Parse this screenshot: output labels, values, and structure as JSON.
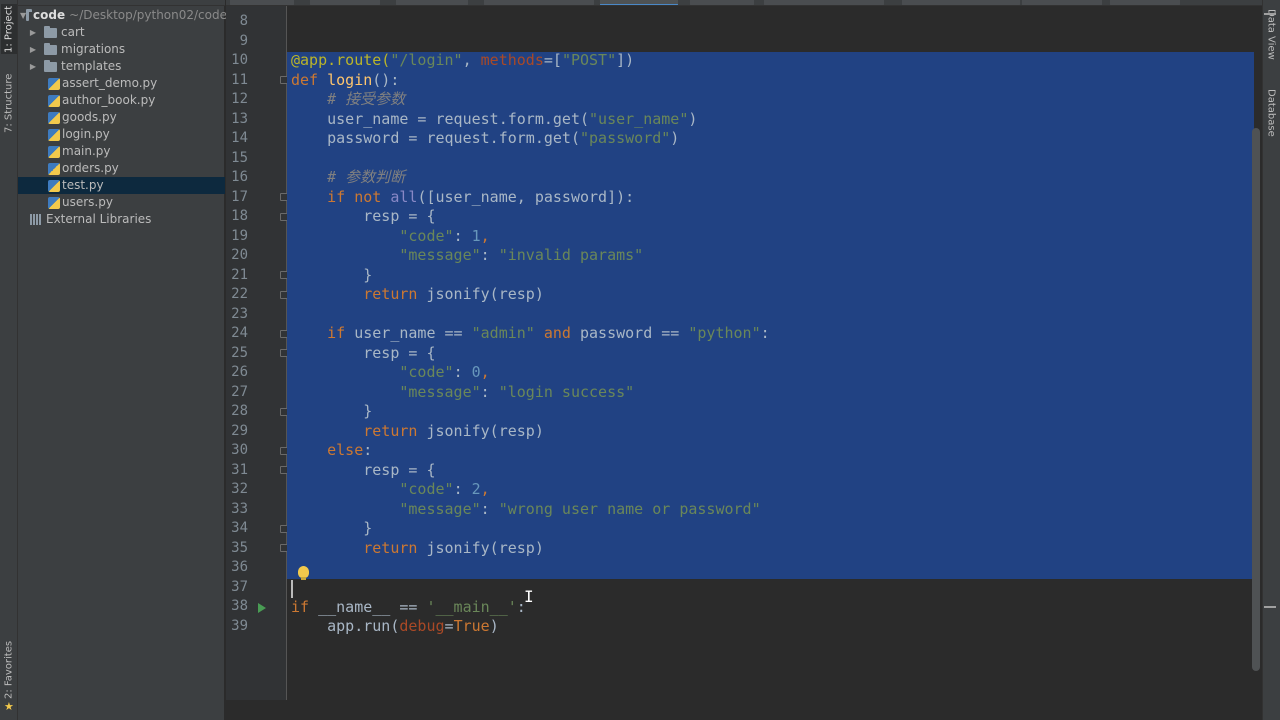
{
  "left_strip": {
    "project_tab": "1: Project",
    "structure_tab": "7: Structure",
    "favorites_tab": "2: Favorites"
  },
  "right_strip": {
    "data_view_tab": "Data View",
    "database_tab": "Database"
  },
  "project": {
    "root_name": "code",
    "root_path": "~/Desktop/python02/code",
    "folders": [
      "cart",
      "migrations",
      "templates"
    ],
    "files": [
      "assert_demo.py",
      "author_book.py",
      "goods.py",
      "login.py",
      "main.py",
      "orders.py",
      "test.py",
      "users.py"
    ],
    "selected_file": "test.py",
    "external_libraries": "External Libraries"
  },
  "editor": {
    "line_numbers": [
      "8",
      "9",
      "10",
      "11",
      "12",
      "13",
      "14",
      "15",
      "16",
      "17",
      "18",
      "19",
      "20",
      "21",
      "22",
      "23",
      "24",
      "25",
      "26",
      "27",
      "28",
      "29",
      "30",
      "31",
      "32",
      "33",
      "34",
      "35",
      "36",
      "37",
      "38",
      "39"
    ],
    "code": {
      "l10_decorator": "@app.route(",
      "l10_route": "\"/login\"",
      "l10_comma": ", ",
      "l10_methods": "methods",
      "l10_eq": "=[",
      "l10_post": "\"POST\"",
      "l10_close": "])",
      "l11_def": "def ",
      "l11_name": "login",
      "l11_rest": "():",
      "l12_comment": "    # 接受参数",
      "l13_a": "    user_name = request.form.get(",
      "l13_str": "\"user_name\"",
      "l13_b": ")",
      "l14_a": "    password = request.form.get(",
      "l14_str": "\"password\"",
      "l14_b": ")",
      "l16_comment": "    # 参数判断",
      "l17_ifnot": "    if not ",
      "l17_all": "all",
      "l17_rest": "([user_name, password]):",
      "l18": "        resp = {",
      "l19_key": "            \"code\"",
      "l19_colon": ": ",
      "l19_val": "1",
      "l19_comma": ",",
      "l20_key": "            \"message\"",
      "l20_colon": ": ",
      "l20_val": "\"invalid params\"",
      "l21": "        }",
      "l22_ret": "        return ",
      "l22_rest": "jsonify(resp)",
      "l24_if": "    if ",
      "l24_a": "user_name == ",
      "l24_admin": "\"admin\"",
      "l24_and": " and ",
      "l24_b": "password == ",
      "l24_py": "\"python\"",
      "l24_c": ":",
      "l25": "        resp = {",
      "l26_key": "            \"code\"",
      "l26_colon": ": ",
      "l26_val": "0",
      "l26_comma": ",",
      "l27_key": "            \"message\"",
      "l27_colon": ": ",
      "l27_val": "\"login success\"",
      "l28": "        }",
      "l29_ret": "        return ",
      "l29_rest": "jsonify(resp)",
      "l30_else": "    else",
      "l30_colon": ":",
      "l31": "        resp = {",
      "l32_key": "            \"code\"",
      "l32_colon": ": ",
      "l32_val": "2",
      "l32_comma": ",",
      "l33_key": "            \"message\"",
      "l33_colon": ": ",
      "l33_val": "\"wrong user name or password\"",
      "l34": "        }",
      "l35_ret": "        return ",
      "l35_rest": "jsonify(resp)",
      "l38_if": "if ",
      "l38_a": "__name__ == ",
      "l38_str": "'__main__'",
      "l38_b": ":",
      "l39_a": "    app.run(",
      "l39_param": "debug",
      "l39_eq": "=",
      "l39_true": "True",
      "l39_b": ")"
    }
  },
  "colors": {
    "keyword": "#cc7832",
    "string": "#6a8759",
    "number": "#6897bb",
    "selection": "#214283",
    "decorator": "#bbb529"
  }
}
